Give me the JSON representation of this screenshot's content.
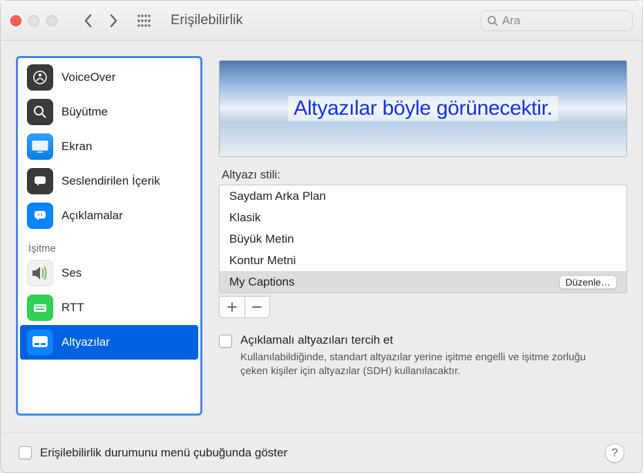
{
  "window": {
    "title": "Erişilebilirlik",
    "search_placeholder": "Ara"
  },
  "sidebar": {
    "items": [
      {
        "label": "VoiceOver",
        "icon_bg": "#3a3a3c",
        "glyph": "voiceover"
      },
      {
        "label": "Büyütme",
        "icon_bg": "#3a3a3c",
        "glyph": "zoom"
      },
      {
        "label": "Ekran",
        "icon_bg": "#0a84ff",
        "glyph": "display"
      },
      {
        "label": "Seslendirilen İçerik",
        "icon_bg": "#3a3a3c",
        "glyph": "speech"
      },
      {
        "label": "Açıklamalar",
        "icon_bg": "#0a84ff",
        "glyph": "descriptions"
      }
    ],
    "hearing_header": "İşitme",
    "hearing_items": [
      {
        "label": "Ses",
        "glyph": "audio"
      },
      {
        "label": "RTT",
        "icon_bg": "#30d158",
        "glyph": "rtt"
      },
      {
        "label": "Altyazılar",
        "icon_bg": "#0a84ff",
        "glyph": "captions",
        "selected": true
      }
    ]
  },
  "main": {
    "preview_text": "Altyazılar böyle görünecektir.",
    "styles_label": "Altyazı stili:",
    "styles": [
      {
        "label": "Saydam Arka Plan"
      },
      {
        "label": "Klasik"
      },
      {
        "label": "Büyük Metin"
      },
      {
        "label": "Kontur Metni"
      },
      {
        "label": "My Captions",
        "selected": true,
        "edit_label": "Düzenle…"
      }
    ],
    "prefer_cc_label": "Açıklamalı altyazıları tercih et",
    "prefer_cc_desc": "Kullanılabildiğinde, standart altyazılar yerine işitme engelli ve işitme zorluğu çeken kişiler için altyazılar (SDH) kullanılacaktır."
  },
  "footer": {
    "menubar_label": "Erişilebilirlik durumunu menü çubuğunda göster",
    "help": "?"
  }
}
